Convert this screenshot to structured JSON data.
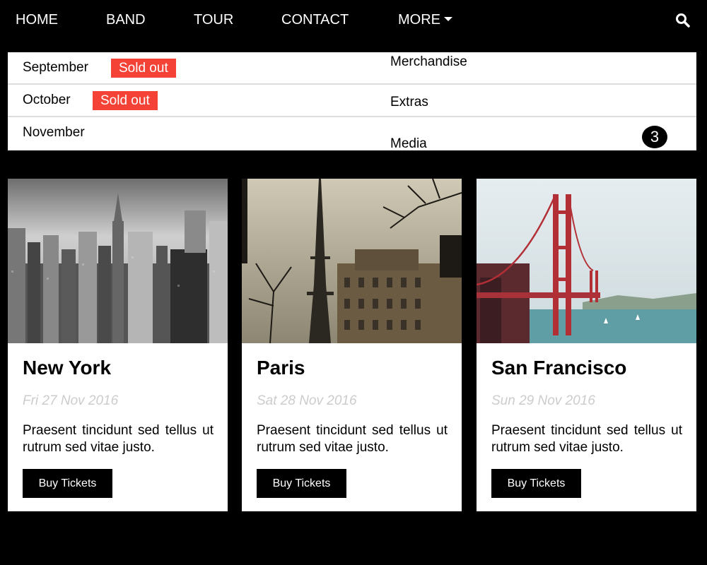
{
  "nav": {
    "items": [
      "HOME",
      "BAND",
      "TOUR",
      "CONTACT",
      "MORE"
    ],
    "search_icon": "search-icon"
  },
  "tour_dates": [
    {
      "month": "September",
      "badge": "Sold out"
    },
    {
      "month": "October",
      "badge": "Sold out"
    },
    {
      "month": "November",
      "badge": ""
    }
  ],
  "more_menu": {
    "items": [
      "Merchandise",
      "Extras",
      "Media"
    ],
    "media_count": "3"
  },
  "cards": [
    {
      "city": "New York",
      "date": "Fri 27 Nov 2016",
      "description": "Praesent tincidunt sed tellus ut rutrum sed vitae justo.",
      "button": "Buy Tickets"
    },
    {
      "city": "Paris",
      "date": "Sat 28 Nov 2016",
      "description": "Praesent tincidunt sed tellus ut rutrum sed vitae justo.",
      "button": "Buy Tickets"
    },
    {
      "city": "San Francisco",
      "date": "Sun 29 Nov 2016",
      "description": "Praesent tincidunt sed tellus ut rutrum sed vitae justo.",
      "button": "Buy Tickets"
    }
  ],
  "colors": {
    "background": "#000000",
    "badge": "#f44336",
    "button": "#000000",
    "date": "#cccccc"
  }
}
